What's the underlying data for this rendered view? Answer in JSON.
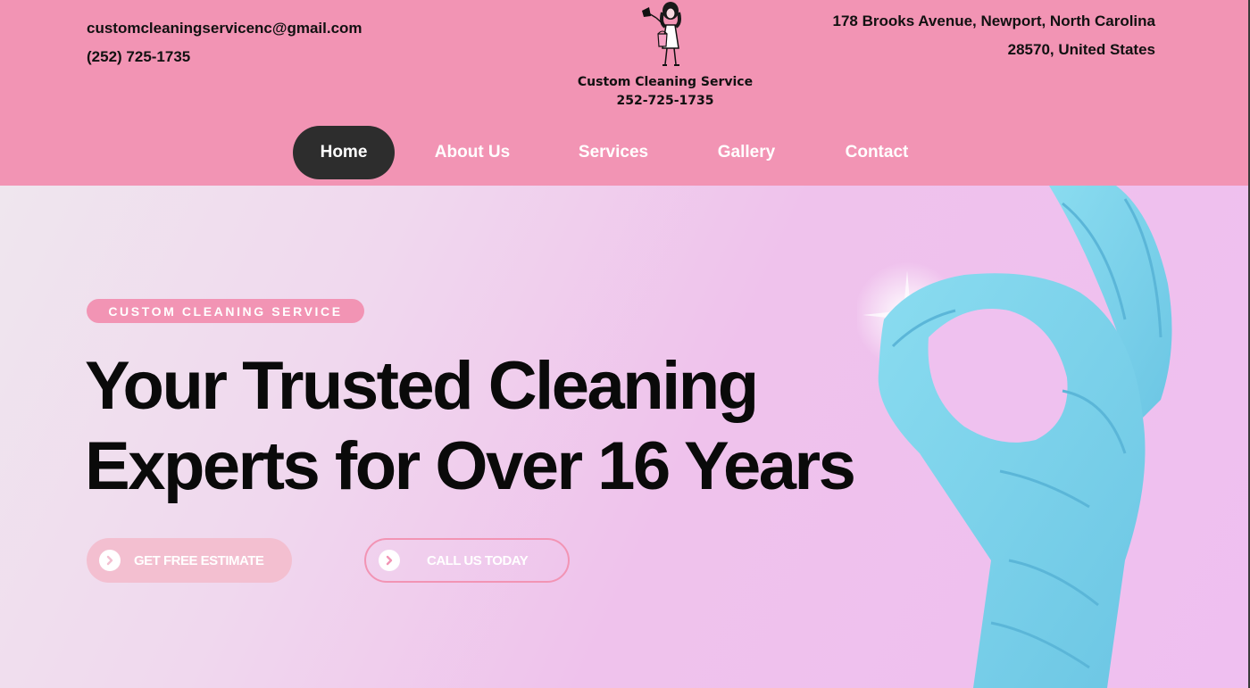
{
  "header": {
    "email": "customcleaningservicenc@gmail.com",
    "phone": "(252) 725-1735",
    "address_line1": "178 Brooks Avenue, Newport, North Carolina",
    "address_line2": "28570, United States"
  },
  "logo": {
    "name": "Custom Cleaning Service",
    "phone": "252-725-1735"
  },
  "nav": {
    "items": [
      {
        "label": "Home",
        "active": true
      },
      {
        "label": "About Us"
      },
      {
        "label": "Services"
      },
      {
        "label": "Gallery"
      },
      {
        "label": "Contact"
      }
    ]
  },
  "hero": {
    "badge": "CUSTOM CLEANING SERVICE",
    "headline_line1": "Your Trusted Cleaning",
    "headline_line2": "Experts for Over 16 Years",
    "btn_estimate": "GET FREE ESTIMATE",
    "btn_call": "CALL US TODAY"
  },
  "colors": {
    "header_pink": "#f294b4",
    "hero_lavender": "#f0c4ec",
    "nav_active": "#2d2d2d",
    "glove_blue": "#7fd3ec"
  },
  "icons": [
    "cleaning-lady-logo-icon",
    "chevron-right-circle-icon",
    "glove-ok-image"
  ]
}
